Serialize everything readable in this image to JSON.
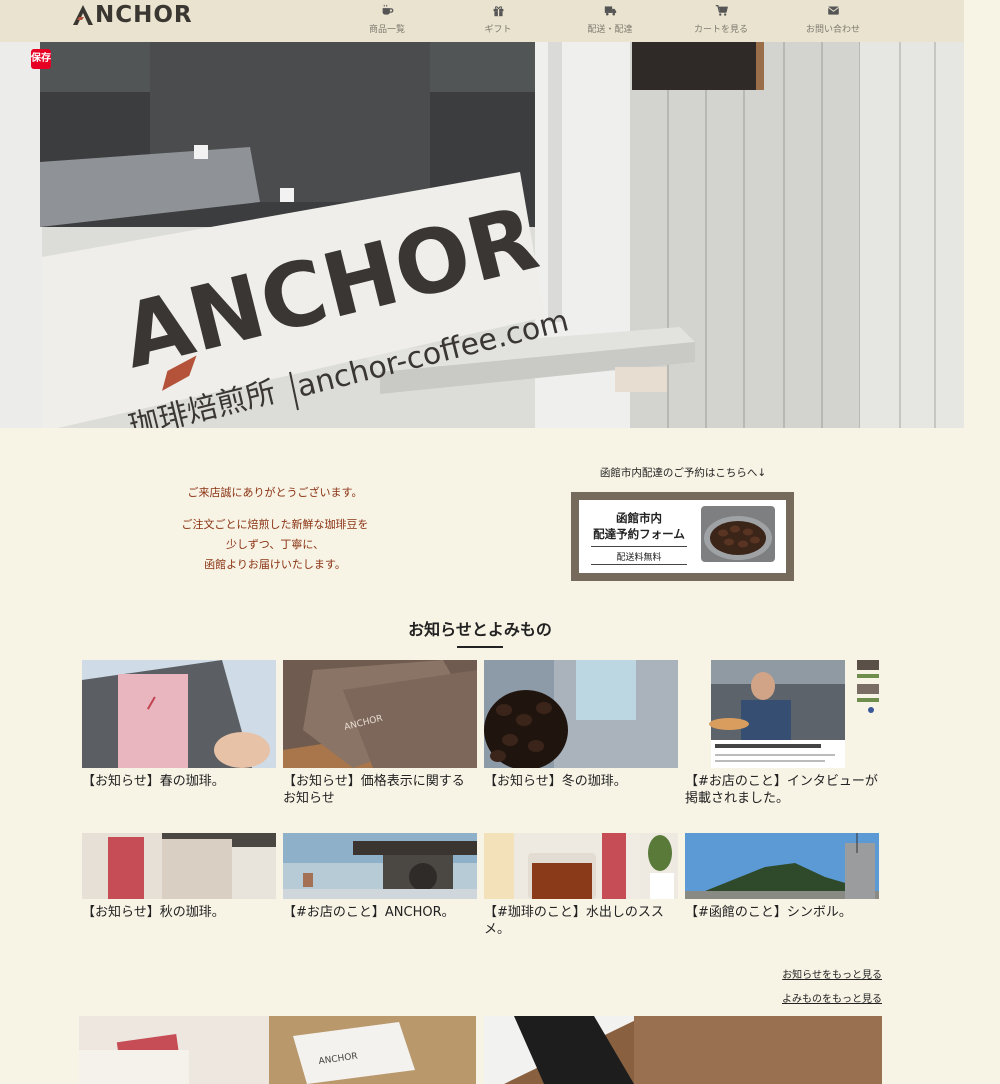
{
  "header": {
    "logo_text": "ANCHOR",
    "nav": [
      {
        "label": "商品一覧",
        "icon": "coffee-cup-icon"
      },
      {
        "label": "ギフト",
        "icon": "gift-icon"
      },
      {
        "label": "配送・配達",
        "icon": "truck-icon"
      },
      {
        "label": "カートを見る",
        "icon": "cart-icon"
      },
      {
        "label": "お問い合わせ",
        "icon": "envelope-icon"
      }
    ]
  },
  "hero": {
    "save_badge": "保存",
    "sign_brand": "ANCHOR",
    "sign_url": "anchor-coffee.com",
    "sign_subtitle": "珈琲焙煎所"
  },
  "intro": {
    "lines_a": [
      "ご来店誠にありがとうございます。"
    ],
    "lines_b": [
      "ご注文ごとに焙煎した新鮮な珈琲豆を",
      "少しずつ、丁寧に、",
      "函館よりお届けいたします。"
    ]
  },
  "delivery": {
    "caption": "函館市内配達のご予約はこちらへ↓",
    "banner_title_1": "函館市内",
    "banner_title_2": "配達予約フォーム",
    "banner_sub": "配送料無料"
  },
  "news": {
    "title": "お知らせとよみもの",
    "items": [
      {
        "title": "【お知らせ】春の珈琲。"
      },
      {
        "title": "【お知らせ】価格表示に関するお知らせ"
      },
      {
        "title": "【お知らせ】冬の珈琲。"
      },
      {
        "title": "【#お店のこと】インタビューが掲載されました。"
      },
      {
        "title": "【お知らせ】秋の珈琲。"
      },
      {
        "title": "【#お店のこと】ANCHOR。"
      },
      {
        "title": "【#珈琲のこと】水出しのススメ。"
      },
      {
        "title": "【#函館のこと】シンボル。"
      }
    ],
    "more_news": "お知らせをもっと見る",
    "more_reading": "よみものをもっと見る"
  },
  "colors": {
    "background": "#f7f3e5",
    "header": "#e9e3cf",
    "intro_text": "#8a3212",
    "banner_frame": "#766a5c",
    "save_badge": "#e60023"
  }
}
